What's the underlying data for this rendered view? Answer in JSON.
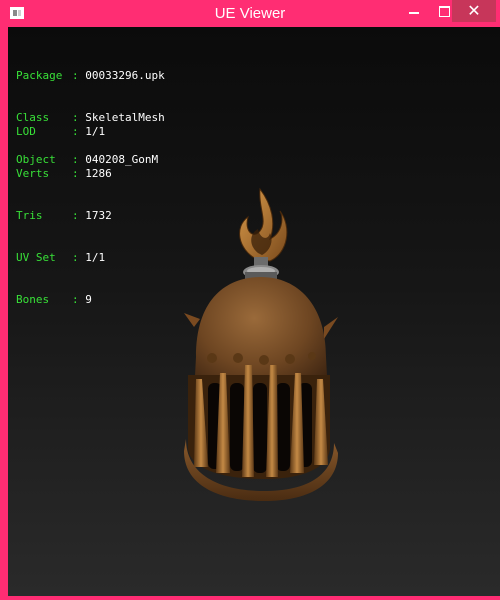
{
  "window": {
    "title": "UE Viewer",
    "app_icon": "app-window-icon",
    "controls": {
      "minimize_icon": "minimize-icon",
      "maximize_icon": "maximize-icon",
      "close_icon": "close-icon",
      "close_glyph": "✕"
    },
    "colors": {
      "frame": "#ff2d73",
      "close_button": "#c7365a",
      "label_text": "#38e038",
      "value_text": "#ffffff"
    }
  },
  "object_info": [
    {
      "label": "Package",
      "value": "00033296.upk"
    },
    {
      "label": "Class  ",
      "value": "SkeletalMesh"
    },
    {
      "label": "Object ",
      "value": "040208_GonM"
    }
  ],
  "mesh_stats": [
    {
      "label": "LOD    ",
      "value": "1/1"
    },
    {
      "label": "Verts  ",
      "value": "1286"
    },
    {
      "label": "Tris   ",
      "value": "1732"
    },
    {
      "label": "UV Set ",
      "value": "1/1"
    },
    {
      "label": "Bones  ",
      "value": "9"
    }
  ],
  "viewport": {
    "model_icon": "helmet-mesh-render"
  }
}
